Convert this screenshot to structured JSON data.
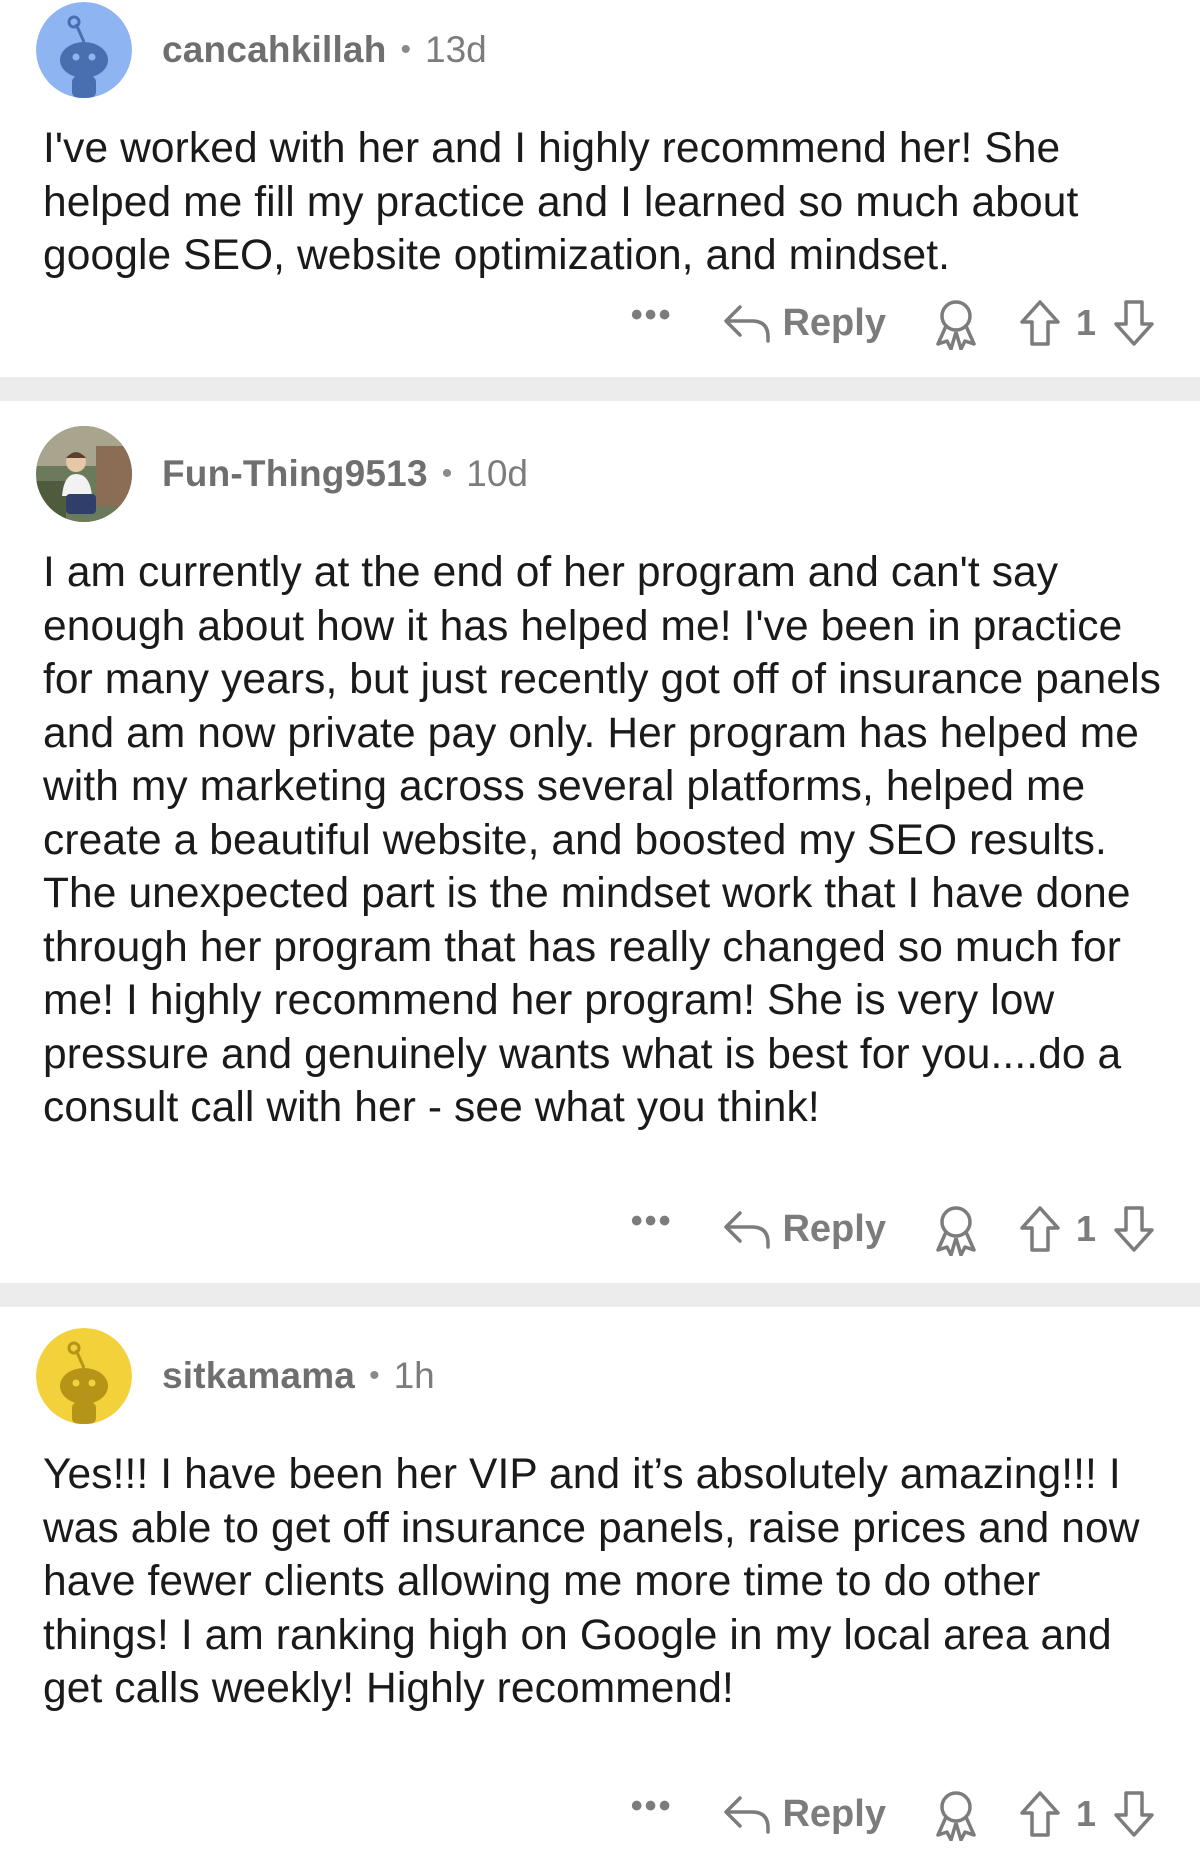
{
  "comments": [
    {
      "username": "cancahkillah",
      "separator": "•",
      "age": "13d",
      "avatar": "snoo-avatar-blue",
      "avatar_color": "#8fb4f2",
      "text": "I've worked with her and I highly recommend her!  She helped me fill my practice and I learned so much about google SEO, website optimization, and mindset.",
      "more_label": "•••",
      "reply_label": "Reply",
      "votes": "1"
    },
    {
      "username": "Fun-Thing9513",
      "separator": "•",
      "age": "10d",
      "avatar": "photo-avatar",
      "avatar_color": "#6b7a5a",
      "text": "I am currently at the end of her program and can't say enough about how it has helped me! I've been in practice for many years, but just recently got off of insurance panels and am now private pay only. Her program has helped me with my marketing across several platforms, helped me create a beautiful website, and boosted my SEO results. The unexpected part is the mindset work that I have done through her program that has really changed so much for me! I highly recommend her program! She is very low pressure and genuinely wants what is best for you....do a consult call with her - see what you think!",
      "more_label": "•••",
      "reply_label": "Reply",
      "votes": "1"
    },
    {
      "username": "sitkamama",
      "separator": "•",
      "age": "1h",
      "avatar": "snoo-avatar-yellow",
      "avatar_color": "#f2d13a",
      "text": "Yes!!! I have been her VIP and it’s absolutely amazing!!! I was able to get off insurance panels, raise prices and now have fewer clients allowing me more time to do other things! I am ranking high on Google in my local area and get calls weekly! Highly recommend!",
      "more_label": "•••",
      "reply_label": "Reply",
      "votes": "1"
    }
  ]
}
